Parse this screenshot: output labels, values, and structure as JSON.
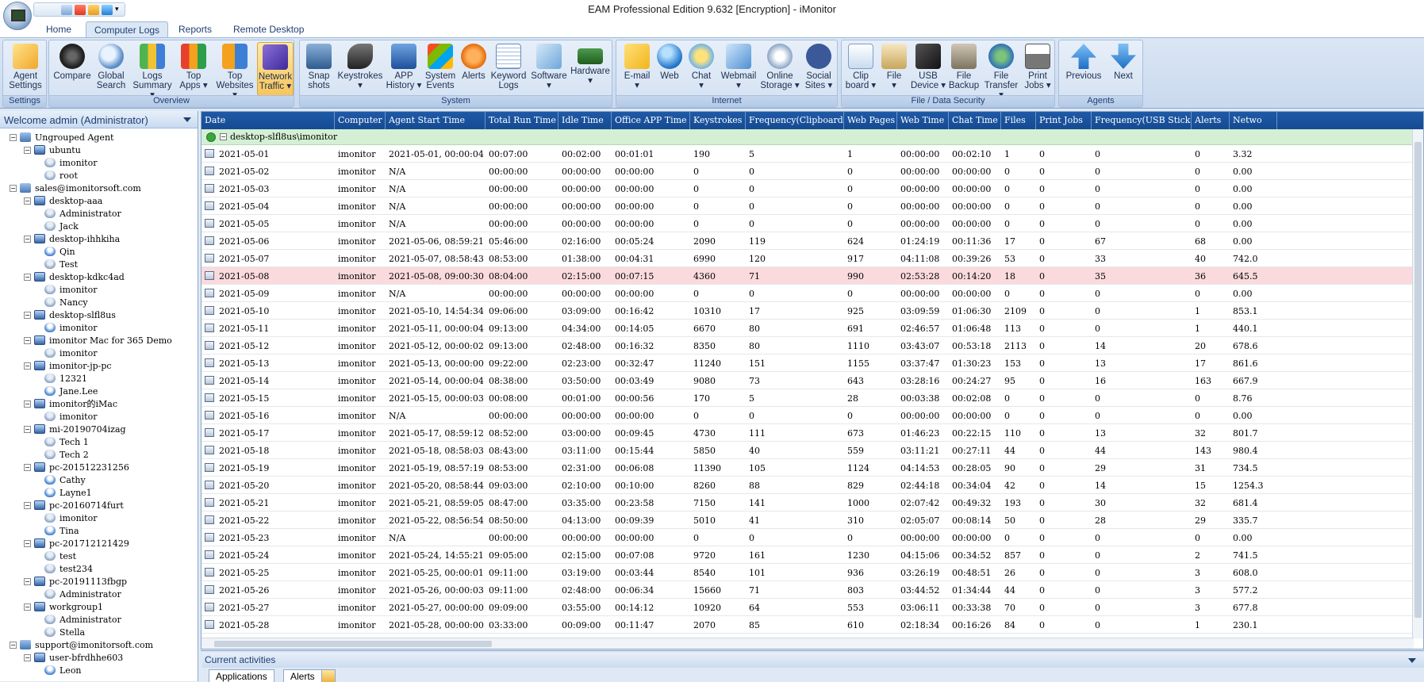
{
  "window": {
    "title": "EAM Professional Edition 9.632 [Encryption] - iMonitor"
  },
  "tabs": [
    {
      "label": "Home"
    },
    {
      "label": "Computer Logs",
      "active": true
    },
    {
      "label": "Reports"
    },
    {
      "label": "Remote Desktop"
    }
  ],
  "ribbon": {
    "groups": {
      "settings": "Settings",
      "overview": "Overview",
      "system": "System",
      "internet": "Internet",
      "file_security": "File / Data Security",
      "agents": "Agents"
    },
    "buttons": {
      "agent_settings": "Agent\nSettings",
      "compare": "Compare",
      "global_search": "Global\nSearch",
      "logs_summary": "Logs\nSummary ▾",
      "top_apps": "Top\nApps ▾",
      "top_websites": "Top\nWebsites ▾",
      "network_traffic": "Network\nTraffic ▾",
      "snapshots": "Snap\nshots",
      "keystrokes": "Keystrokes\n▾",
      "app_history": "APP\nHistory ▾",
      "system_events": "System\nEvents",
      "alerts": "Alerts",
      "keyword_logs": "Keyword\nLogs",
      "software": "Software\n▾",
      "hardware": "Hardware\n▾",
      "email": "E-mail\n▾",
      "web": "Web",
      "chat": "Chat\n▾",
      "webmail": "Webmail\n▾",
      "online_storage": "Online\nStorage ▾",
      "social_sites": "Social\nSites ▾",
      "clipboard": "Clip\nboard ▾",
      "file": "File\n▾",
      "usb_device": "USB\nDevice ▾",
      "file_backup": "File\nBackup",
      "file_transfer": "File\nTransfer ▾",
      "print_jobs": "Print\nJobs ▾",
      "previous": "Previous",
      "next": "Next"
    }
  },
  "left_panel": {
    "title": "Welcome admin (Administrator)",
    "tree": [
      {
        "label": "Ungrouped Agent",
        "level": 0,
        "kind": "grp"
      },
      {
        "label": "ubuntu",
        "level": 1,
        "kind": "pc"
      },
      {
        "label": "imonitor",
        "level": 2,
        "kind": "usr"
      },
      {
        "label": "root",
        "level": 2,
        "kind": "usr"
      },
      {
        "label": "sales@imonitorsoft.com",
        "level": 0,
        "kind": "grp"
      },
      {
        "label": "desktop-aaa",
        "level": 1,
        "kind": "pc"
      },
      {
        "label": "Administrator",
        "level": 2,
        "kind": "usr"
      },
      {
        "label": "Jack",
        "level": 2,
        "kind": "usr"
      },
      {
        "label": "desktop-ihhkiha",
        "level": 1,
        "kind": "pc"
      },
      {
        "label": "Qin",
        "level": 2,
        "kind": "usr2"
      },
      {
        "label": "Test",
        "level": 2,
        "kind": "usr"
      },
      {
        "label": "desktop-kdkc4ad",
        "level": 1,
        "kind": "pc"
      },
      {
        "label": "imonitor",
        "level": 2,
        "kind": "usr"
      },
      {
        "label": "Nancy",
        "level": 2,
        "kind": "usr"
      },
      {
        "label": "desktop-slfl8us",
        "level": 1,
        "kind": "pc"
      },
      {
        "label": "imonitor",
        "level": 2,
        "kind": "usr2"
      },
      {
        "label": "imonitor Mac for 365 Demo",
        "level": 1,
        "kind": "pc"
      },
      {
        "label": "imonitor",
        "level": 2,
        "kind": "usr"
      },
      {
        "label": "imonitor-jp-pc",
        "level": 1,
        "kind": "pc"
      },
      {
        "label": "12321",
        "level": 2,
        "kind": "usr"
      },
      {
        "label": "Jane.Lee",
        "level": 2,
        "kind": "usr2"
      },
      {
        "label": "imonitor的iMac",
        "level": 1,
        "kind": "pc"
      },
      {
        "label": "imonitor",
        "level": 2,
        "kind": "usr"
      },
      {
        "label": "mi-20190704izag",
        "level": 1,
        "kind": "pc"
      },
      {
        "label": "Tech 1",
        "level": 2,
        "kind": "usr"
      },
      {
        "label": "Tech 2",
        "level": 2,
        "kind": "usr"
      },
      {
        "label": "pc-201512231256",
        "level": 1,
        "kind": "pc"
      },
      {
        "label": "Cathy",
        "level": 2,
        "kind": "usr2"
      },
      {
        "label": "Layne1",
        "level": 2,
        "kind": "usr2"
      },
      {
        "label": "pc-20160714furt",
        "level": 1,
        "kind": "pc"
      },
      {
        "label": "imonitor",
        "level": 2,
        "kind": "usr"
      },
      {
        "label": "Tina",
        "level": 2,
        "kind": "usr2"
      },
      {
        "label": "pc-201712121429",
        "level": 1,
        "kind": "pc"
      },
      {
        "label": "test",
        "level": 2,
        "kind": "usr"
      },
      {
        "label": "test234",
        "level": 2,
        "kind": "usr"
      },
      {
        "label": "pc-20191113fbgp",
        "level": 1,
        "kind": "pc"
      },
      {
        "label": "Administrator",
        "level": 2,
        "kind": "usr"
      },
      {
        "label": "workgroup1",
        "level": 1,
        "kind": "pc"
      },
      {
        "label": "Administrator",
        "level": 2,
        "kind": "usr"
      },
      {
        "label": "Stella",
        "level": 2,
        "kind": "usr"
      },
      {
        "label": "support@imonitorsoft.com",
        "level": 0,
        "kind": "grp"
      },
      {
        "label": "user-bfrdhhe603",
        "level": 1,
        "kind": "pc"
      },
      {
        "label": "Leon",
        "level": 2,
        "kind": "usr2"
      }
    ]
  },
  "grid": {
    "columns": [
      "Date",
      "Computer",
      "Agent Start Time",
      "Total Run Time",
      "Idle Time",
      "Office APP Time",
      "Keystrokes",
      "Frequency(Clipboard)",
      "Web Pages",
      "Web Time",
      "Chat Time",
      "Files",
      "Print Jobs",
      "Frequency(USB Stick)",
      "Alerts",
      "Netwo"
    ],
    "group_label": "desktop-slfl8us\\imonitor",
    "highlight_row": 7,
    "rows": [
      [
        "2021-05-01",
        "imonitor",
        "2021-05-01, 00:00:04",
        "00:07:00",
        "00:02:00",
        "00:01:01",
        "190",
        "5",
        "1",
        "00:00:00",
        "00:02:10",
        "1",
        "0",
        "0",
        "0",
        "3.32"
      ],
      [
        "2021-05-02",
        "imonitor",
        "N/A",
        "00:00:00",
        "00:00:00",
        "00:00:00",
        "0",
        "0",
        "0",
        "00:00:00",
        "00:00:00",
        "0",
        "0",
        "0",
        "0",
        "0.00"
      ],
      [
        "2021-05-03",
        "imonitor",
        "N/A",
        "00:00:00",
        "00:00:00",
        "00:00:00",
        "0",
        "0",
        "0",
        "00:00:00",
        "00:00:00",
        "0",
        "0",
        "0",
        "0",
        "0.00"
      ],
      [
        "2021-05-04",
        "imonitor",
        "N/A",
        "00:00:00",
        "00:00:00",
        "00:00:00",
        "0",
        "0",
        "0",
        "00:00:00",
        "00:00:00",
        "0",
        "0",
        "0",
        "0",
        "0.00"
      ],
      [
        "2021-05-05",
        "imonitor",
        "N/A",
        "00:00:00",
        "00:00:00",
        "00:00:00",
        "0",
        "0",
        "0",
        "00:00:00",
        "00:00:00",
        "0",
        "0",
        "0",
        "0",
        "0.00"
      ],
      [
        "2021-05-06",
        "imonitor",
        "2021-05-06, 08:59:21",
        "05:46:00",
        "02:16:00",
        "00:05:24",
        "2090",
        "119",
        "624",
        "01:24:19",
        "00:11:36",
        "17",
        "0",
        "67",
        "68",
        "0.00"
      ],
      [
        "2021-05-07",
        "imonitor",
        "2021-05-07, 08:58:43",
        "08:53:00",
        "01:38:00",
        "00:04:31",
        "6990",
        "120",
        "917",
        "04:11:08",
        "00:39:26",
        "53",
        "0",
        "33",
        "40",
        "742.0"
      ],
      [
        "2021-05-08",
        "imonitor",
        "2021-05-08, 09:00:30",
        "08:04:00",
        "02:15:00",
        "00:07:15",
        "4360",
        "71",
        "990",
        "02:53:28",
        "00:14:20",
        "18",
        "0",
        "35",
        "36",
        "645.5"
      ],
      [
        "2021-05-09",
        "imonitor",
        "N/A",
        "00:00:00",
        "00:00:00",
        "00:00:00",
        "0",
        "0",
        "0",
        "00:00:00",
        "00:00:00",
        "0",
        "0",
        "0",
        "0",
        "0.00"
      ],
      [
        "2021-05-10",
        "imonitor",
        "2021-05-10, 14:54:34",
        "09:06:00",
        "03:09:00",
        "00:16:42",
        "10310",
        "17",
        "925",
        "03:09:59",
        "01:06:30",
        "2109",
        "0",
        "0",
        "1",
        "853.1"
      ],
      [
        "2021-05-11",
        "imonitor",
        "2021-05-11, 00:00:04",
        "09:13:00",
        "04:34:00",
        "00:14:05",
        "6670",
        "80",
        "691",
        "02:46:57",
        "01:06:48",
        "113",
        "0",
        "0",
        "1",
        "440.1"
      ],
      [
        "2021-05-12",
        "imonitor",
        "2021-05-12, 00:00:02",
        "09:13:00",
        "02:48:00",
        "00:16:32",
        "8350",
        "80",
        "1110",
        "03:43:07",
        "00:53:18",
        "2113",
        "0",
        "14",
        "20",
        "678.6"
      ],
      [
        "2021-05-13",
        "imonitor",
        "2021-05-13, 00:00:00",
        "09:22:00",
        "02:23:00",
        "00:32:47",
        "11240",
        "151",
        "1155",
        "03:37:47",
        "01:30:23",
        "153",
        "0",
        "13",
        "17",
        "861.6"
      ],
      [
        "2021-05-14",
        "imonitor",
        "2021-05-14, 00:00:04",
        "08:38:00",
        "03:50:00",
        "00:03:49",
        "9080",
        "73",
        "643",
        "03:28:16",
        "00:24:27",
        "95",
        "0",
        "16",
        "163",
        "667.9"
      ],
      [
        "2021-05-15",
        "imonitor",
        "2021-05-15, 00:00:03",
        "00:08:00",
        "00:01:00",
        "00:00:56",
        "170",
        "5",
        "28",
        "00:03:38",
        "00:02:08",
        "0",
        "0",
        "0",
        "0",
        "8.76"
      ],
      [
        "2021-05-16",
        "imonitor",
        "N/A",
        "00:00:00",
        "00:00:00",
        "00:00:00",
        "0",
        "0",
        "0",
        "00:00:00",
        "00:00:00",
        "0",
        "0",
        "0",
        "0",
        "0.00"
      ],
      [
        "2021-05-17",
        "imonitor",
        "2021-05-17, 08:59:12",
        "08:52:00",
        "03:00:00",
        "00:09:45",
        "4730",
        "111",
        "673",
        "01:46:23",
        "00:22:15",
        "110",
        "0",
        "13",
        "32",
        "801.7"
      ],
      [
        "2021-05-18",
        "imonitor",
        "2021-05-18, 08:58:03",
        "08:43:00",
        "03:11:00",
        "00:15:44",
        "5850",
        "40",
        "559",
        "03:11:21",
        "00:27:11",
        "44",
        "0",
        "44",
        "143",
        "980.4"
      ],
      [
        "2021-05-19",
        "imonitor",
        "2021-05-19, 08:57:19",
        "08:53:00",
        "02:31:00",
        "00:06:08",
        "11390",
        "105",
        "1124",
        "04:14:53",
        "00:28:05",
        "90",
        "0",
        "29",
        "31",
        "734.5"
      ],
      [
        "2021-05-20",
        "imonitor",
        "2021-05-20, 08:58:44",
        "09:03:00",
        "02:10:00",
        "00:10:00",
        "8260",
        "88",
        "829",
        "02:44:18",
        "00:34:04",
        "42",
        "0",
        "14",
        "15",
        "1254.3"
      ],
      [
        "2021-05-21",
        "imonitor",
        "2021-05-21, 08:59:05",
        "08:47:00",
        "03:35:00",
        "00:23:58",
        "7150",
        "141",
        "1000",
        "02:07:42",
        "00:49:32",
        "193",
        "0",
        "30",
        "32",
        "681.4"
      ],
      [
        "2021-05-22",
        "imonitor",
        "2021-05-22, 08:56:54",
        "08:50:00",
        "04:13:00",
        "00:09:39",
        "5010",
        "41",
        "310",
        "02:05:07",
        "00:08:14",
        "50",
        "0",
        "28",
        "29",
        "335.7"
      ],
      [
        "2021-05-23",
        "imonitor",
        "N/A",
        "00:00:00",
        "00:00:00",
        "00:00:00",
        "0",
        "0",
        "0",
        "00:00:00",
        "00:00:00",
        "0",
        "0",
        "0",
        "0",
        "0.00"
      ],
      [
        "2021-05-24",
        "imonitor",
        "2021-05-24, 14:55:21",
        "09:05:00",
        "02:15:00",
        "00:07:08",
        "9720",
        "161",
        "1230",
        "04:15:06",
        "00:34:52",
        "857",
        "0",
        "0",
        "2",
        "741.5"
      ],
      [
        "2021-05-25",
        "imonitor",
        "2021-05-25, 00:00:01",
        "09:11:00",
        "03:19:00",
        "00:03:44",
        "8540",
        "101",
        "936",
        "03:26:19",
        "00:48:51",
        "26",
        "0",
        "0",
        "3",
        "608.0"
      ],
      [
        "2021-05-26",
        "imonitor",
        "2021-05-26, 00:00:03",
        "09:11:00",
        "02:48:00",
        "00:06:34",
        "15660",
        "71",
        "803",
        "03:44:52",
        "01:34:44",
        "44",
        "0",
        "0",
        "3",
        "577.2"
      ],
      [
        "2021-05-27",
        "imonitor",
        "2021-05-27, 00:00:00",
        "09:09:00",
        "03:55:00",
        "00:14:12",
        "10920",
        "64",
        "553",
        "03:06:11",
        "00:33:38",
        "70",
        "0",
        "0",
        "3",
        "677.8"
      ],
      [
        "2021-05-28",
        "imonitor",
        "2021-05-28, 00:00:00",
        "03:33:00",
        "00:09:00",
        "00:11:47",
        "2070",
        "85",
        "610",
        "02:18:34",
        "00:16:26",
        "84",
        "0",
        "0",
        "1",
        "230.1"
      ]
    ]
  },
  "activities": {
    "title": "Current activities",
    "tabs": [
      "Applications",
      "Alerts"
    ]
  }
}
